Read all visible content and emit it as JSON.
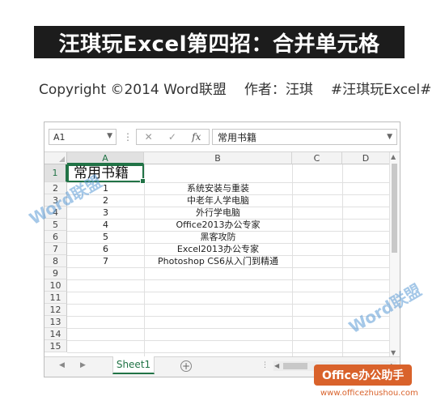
{
  "banner": {
    "title": "汪琪玩Excel第四招：合并单元格"
  },
  "credits": {
    "copyright": "Copyright ©2014 Word联盟",
    "author": "作者：汪琪",
    "hashtag": "#汪琪玩Excel#"
  },
  "excel": {
    "name_box": "A1",
    "formula_value": "常用书籍",
    "fx_label": "fx",
    "columns": [
      "A",
      "B",
      "C",
      "D"
    ],
    "rows": [
      "1",
      "2",
      "3",
      "4",
      "5",
      "6",
      "7",
      "8",
      "9",
      "10",
      "11",
      "12",
      "13",
      "14",
      "15"
    ],
    "a1_value": "常用书籍",
    "data_rows": [
      {
        "num": "1",
        "book": "系统安装与重装"
      },
      {
        "num": "2",
        "book": "中老年人学电脑"
      },
      {
        "num": "3",
        "book": "外行学电脑"
      },
      {
        "num": "4",
        "book": "Office2013办公专家"
      },
      {
        "num": "5",
        "book": "黑客攻防"
      },
      {
        "num": "6",
        "book": "Excel2013办公专家"
      },
      {
        "num": "7",
        "book": "Photoshop CS6从入门到精通"
      }
    ],
    "sheet_tab": "Sheet1",
    "accent_color": "#217346"
  },
  "watermark": {
    "text": "Word联盟"
  },
  "branding": {
    "badge": "Office办公助手",
    "url": "www.officezhushou.com",
    "badge_color": "#d9622b"
  }
}
